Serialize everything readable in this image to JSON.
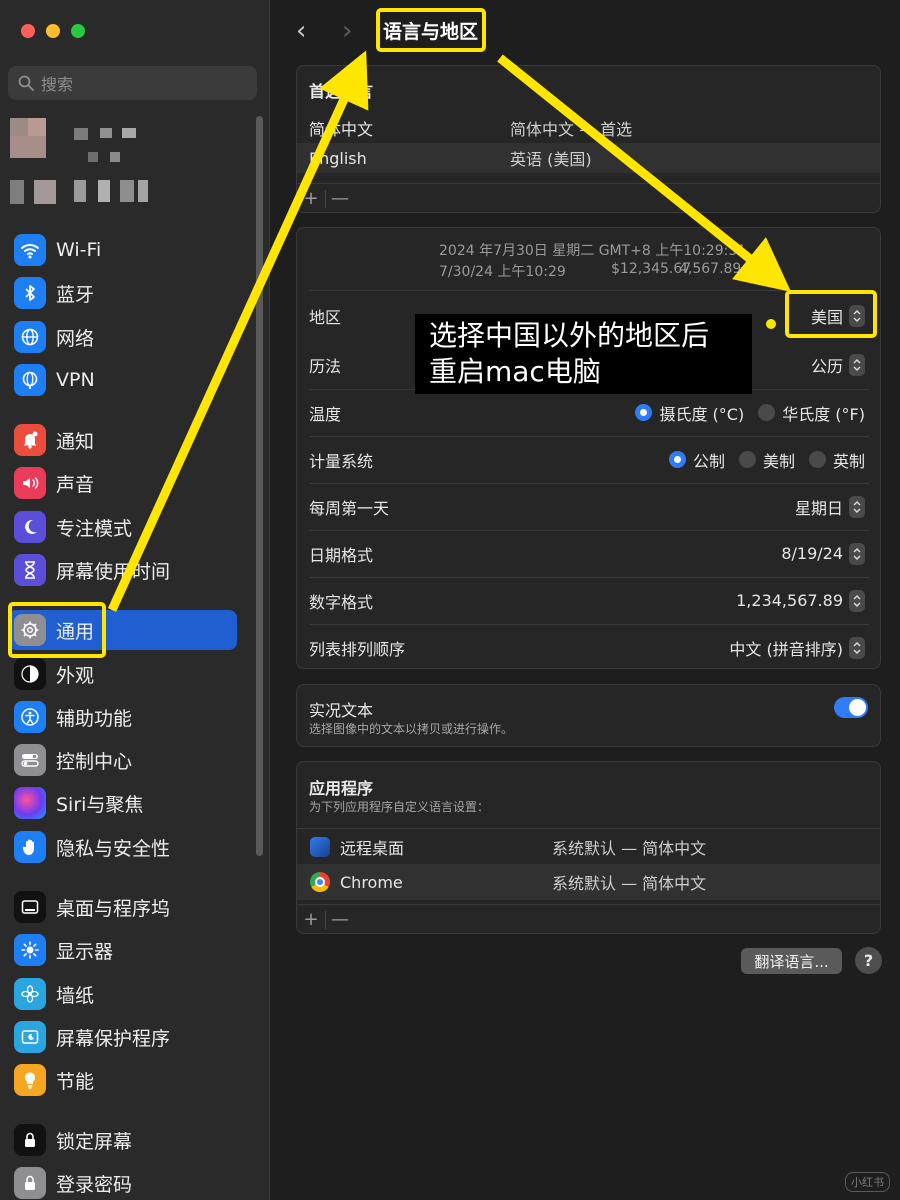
{
  "window": {
    "controls": [
      "close",
      "minimize",
      "zoom"
    ]
  },
  "search": {
    "placeholder": "搜索"
  },
  "sidebar": {
    "items": [
      {
        "label": "Wi-Fi",
        "icon": "wifi-icon",
        "color": "#1e7ff5"
      },
      {
        "label": "蓝牙",
        "icon": "bluetooth-icon",
        "color": "#1e7ff5"
      },
      {
        "label": "网络",
        "icon": "globe-icon",
        "color": "#1e7ff5"
      },
      {
        "label": "VPN",
        "icon": "vpn-globe-icon",
        "color": "#1e7ff5"
      },
      {
        "label": "通知",
        "icon": "bell-icon",
        "color": "#eb4d3d"
      },
      {
        "label": "声音",
        "icon": "speaker-icon",
        "color": "#eb3b5a"
      },
      {
        "label": "专注模式",
        "icon": "moon-icon",
        "color": "#5b4fd9"
      },
      {
        "label": "屏幕使用时间",
        "icon": "hourglass-icon",
        "color": "#5b4fd9"
      },
      {
        "label": "通用",
        "icon": "gear-icon",
        "color": "#8e8e93",
        "selected": true
      },
      {
        "label": "外观",
        "icon": "appearance-icon",
        "color": "#111111"
      },
      {
        "label": "辅助功能",
        "icon": "accessibility-icon",
        "color": "#1e7ff5"
      },
      {
        "label": "控制中心",
        "icon": "control-center-icon",
        "color": "#8e8e93"
      },
      {
        "label": "Siri与聚焦",
        "icon": "siri-icon",
        "color": "#3a2a6e"
      },
      {
        "label": "隐私与安全性",
        "icon": "hand-icon",
        "color": "#1e7ff5"
      },
      {
        "label": "桌面与程序坞",
        "icon": "dock-icon",
        "color": "#111111"
      },
      {
        "label": "显示器",
        "icon": "sun-icon",
        "color": "#1e7ff5"
      },
      {
        "label": "墙纸",
        "icon": "flower-icon",
        "color": "#2aa5e0"
      },
      {
        "label": "屏幕保护程序",
        "icon": "screensaver-icon",
        "color": "#2aa5e0"
      },
      {
        "label": "节能",
        "icon": "bulb-icon",
        "color": "#f5a623"
      },
      {
        "label": "锁定屏幕",
        "icon": "lock-icon",
        "color": "#111111"
      },
      {
        "label": "登录密码",
        "icon": "lock-alt-icon",
        "color": "#8e8e93"
      }
    ]
  },
  "header": {
    "back": "‹",
    "forward": "›",
    "title": "语言与地区"
  },
  "preferred_languages": {
    "title": "首选语言",
    "rows": [
      {
        "name": "简体中文",
        "value": "简体中文 — 首选"
      },
      {
        "name": "English",
        "value": "英语 (美国)"
      }
    ],
    "add": "+",
    "remove": "—"
  },
  "format_preview": {
    "line1": "2024 年7月30日 星期二 GMT+8 上午10:29:31",
    "line2_date": "7/30/24 上午10:29",
    "line2_currency": "$12,345.67",
    "line2_number": "4,567.89"
  },
  "settings": {
    "region": {
      "label": "地区",
      "value": "美国"
    },
    "calendar": {
      "label": "历法",
      "value": "公历"
    },
    "temperature": {
      "label": "温度",
      "opt1": "摄氏度 (°C)",
      "opt2": "华氏度 (°F)",
      "selected": "opt1"
    },
    "measurement": {
      "label": "计量系统",
      "opt1": "公制",
      "opt2": "美制",
      "opt3": "英制",
      "selected": "opt1"
    },
    "first_weekday": {
      "label": "每周第一天",
      "value": "星期日"
    },
    "date_format": {
      "label": "日期格式",
      "value": "8/19/24"
    },
    "number_format": {
      "label": "数字格式",
      "value": "1,234,567.89"
    },
    "list_sort": {
      "label": "列表排列顺序",
      "value": "中文 (拼音排序)"
    }
  },
  "live_text": {
    "title": "实况文本",
    "desc": "选择图像中的文本以拷贝或进行操作。",
    "enabled": true
  },
  "applications": {
    "title": "应用程序",
    "desc": "为下列应用程序自定义语言设置：",
    "rows": [
      {
        "name": "远程桌面",
        "value": "系统默认 — 简体中文",
        "icon": "remote-desktop-icon"
      },
      {
        "name": "Chrome",
        "value": "系统默认 — 简体中文",
        "icon": "chrome-icon"
      }
    ],
    "add": "+",
    "remove": "—"
  },
  "buttons": {
    "translate": "翻译语言...",
    "help": "?"
  },
  "annotation": {
    "line1": "选择中国以外的地区后",
    "line2": "重启mac电脑",
    "highlight_color": "#ffe600"
  },
  "watermark": "小红书"
}
